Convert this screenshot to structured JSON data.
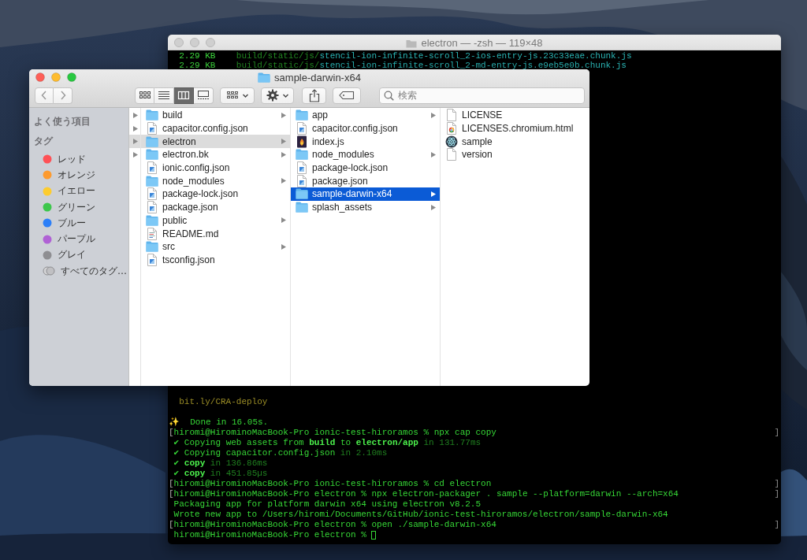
{
  "terminal": {
    "title": "electron — -zsh — 119×48",
    "lines_top": [
      {
        "kind": "text",
        "segments": [
          {
            "text": "  2.29 KB",
            "kind": "size"
          },
          {
            "text": "    build/static/js/",
            "kind": "path"
          },
          {
            "text": "stencil-ion-infinite-scroll_2-ios-entry-js.23c33eae.chunk.js",
            "kind": "file"
          }
        ]
      },
      {
        "kind": "text",
        "segments": [
          {
            "text": "  2.29 KB",
            "kind": "size"
          },
          {
            "text": "    build/static/js/",
            "kind": "path"
          },
          {
            "text": "stencil-ion-infinite-scroll_2-md-entry-js.e9eb5e0b.chunk.js",
            "kind": "file"
          }
        ]
      }
    ],
    "lines_bottom": [
      {
        "kind": "text",
        "segments": [
          {
            "text": "  bit.ly/CRA-deploy",
            "kind": "hint"
          }
        ]
      },
      {
        "kind": "blank"
      },
      {
        "kind": "text",
        "segments": [
          {
            "text": "✨  Done in 16.05s.",
            "kind": "plain"
          }
        ]
      },
      {
        "kind": "text",
        "segments": [
          {
            "text": "[",
            "kind": "bracket"
          },
          {
            "text": "hiromi@HirominoMacBook-Pro ionic-test-hiroramos % npx cap copy",
            "kind": "plain"
          }
        ],
        "end_mark": "]"
      },
      {
        "kind": "text",
        "segments": [
          {
            "text": " ✔ Copying web assets from ",
            "kind": "plain"
          },
          {
            "text": "build",
            "kind": "bold"
          },
          {
            "text": " to ",
            "kind": "plain"
          },
          {
            "text": "electron/app",
            "kind": "bold"
          },
          {
            "text": " in 131.77ms",
            "kind": "dim"
          }
        ]
      },
      {
        "kind": "text",
        "segments": [
          {
            "text": " ✔ Copying capacitor.config.json",
            "kind": "plain"
          },
          {
            "text": " in 2.10ms",
            "kind": "dim"
          }
        ]
      },
      {
        "kind": "text",
        "segments": [
          {
            "text": " ✔ ",
            "kind": "plain"
          },
          {
            "text": "copy",
            "kind": "bold"
          },
          {
            "text": " in 136.86ms",
            "kind": "dim"
          }
        ]
      },
      {
        "kind": "text",
        "segments": [
          {
            "text": " ✔ ",
            "kind": "plain"
          },
          {
            "text": "copy",
            "kind": "bold"
          },
          {
            "text": " in 451.85µs",
            "kind": "dim"
          }
        ]
      },
      {
        "kind": "text",
        "segments": [
          {
            "text": "[",
            "kind": "bracket"
          },
          {
            "text": "hiromi@HirominoMacBook-Pro ionic-test-hiroramos % cd electron",
            "kind": "plain"
          }
        ],
        "end_mark": "]"
      },
      {
        "kind": "text",
        "segments": [
          {
            "text": "[",
            "kind": "bracket"
          },
          {
            "text": "hiromi@HirominoMacBook-Pro electron % npx electron-packager . sample --platform=darwin --arch=x64",
            "kind": "plain"
          }
        ],
        "end_mark": "]"
      },
      {
        "kind": "text",
        "segments": [
          {
            "text": " Packaging app for platform darwin x64 using electron v8.2.5",
            "kind": "plain"
          }
        ]
      },
      {
        "kind": "text",
        "segments": [
          {
            "text": " Wrote new app to /Users/hiromi/Documents/GitHub/ionic-test-hiroramos/electron/sample-darwin-x64",
            "kind": "plain"
          }
        ]
      },
      {
        "kind": "text",
        "segments": [
          {
            "text": "[",
            "kind": "bracket"
          },
          {
            "text": "hiromi@HirominoMacBook-Pro electron % open ./sample-darwin-x64",
            "kind": "plain"
          }
        ],
        "end_mark": "]"
      },
      {
        "kind": "text",
        "segments": [
          {
            "text": " hiromi@HirominoMacBook-Pro electron % ",
            "kind": "plain"
          }
        ],
        "cursor": true
      }
    ]
  },
  "finder": {
    "title": "sample-darwin-x64",
    "toolbar": {
      "view_modes": [
        {
          "kind": "icons",
          "selected": false
        },
        {
          "kind": "list",
          "selected": false
        },
        {
          "kind": "columns",
          "selected": true
        },
        {
          "kind": "gallery",
          "selected": false
        }
      ],
      "search": {
        "placeholder": "検索"
      }
    },
    "sidebar": {
      "sections": [
        {
          "heading": "よく使う項目"
        },
        {
          "heading": "タグ",
          "items": [
            {
              "label": "レッド",
              "kind": "tag",
              "color": "#fe5156"
            },
            {
              "label": "オレンジ",
              "kind": "tag",
              "color": "#fd9a2e"
            },
            {
              "label": "イエロー",
              "kind": "tag",
              "color": "#fdcc2e"
            },
            {
              "label": "グリーン",
              "kind": "tag",
              "color": "#3dc74c"
            },
            {
              "label": "ブルー",
              "kind": "tag",
              "color": "#2c7ff8"
            },
            {
              "label": "パープル",
              "kind": "tag",
              "color": "#b061d5"
            },
            {
              "label": "グレイ",
              "kind": "tag",
              "color": "#8e8e92"
            },
            {
              "label": "すべてのタグ…",
              "kind": "all"
            }
          ]
        }
      ]
    },
    "parent_column": {
      "rows": [
        {
          "selected": false
        },
        {
          "selected": false
        },
        {
          "selected": true
        },
        {
          "selected": false
        }
      ]
    },
    "columns": [
      {
        "items": [
          {
            "name": "build",
            "kind": "folder",
            "has_children": true,
            "selected": false
          },
          {
            "name": "capacitor.config.json",
            "kind": "json",
            "has_children": false,
            "selected": false
          },
          {
            "name": "electron",
            "kind": "folder",
            "has_children": true,
            "selected": true
          },
          {
            "name": "electron.bk",
            "kind": "folder",
            "has_children": true,
            "selected": false
          },
          {
            "name": "ionic.config.json",
            "kind": "json",
            "has_children": false,
            "selected": false
          },
          {
            "name": "node_modules",
            "kind": "folder",
            "has_children": true,
            "selected": false
          },
          {
            "name": "package-lock.json",
            "kind": "json",
            "has_children": false,
            "selected": false
          },
          {
            "name": "package.json",
            "kind": "json",
            "has_children": false,
            "selected": false
          },
          {
            "name": "public",
            "kind": "folder",
            "has_children": true,
            "selected": false
          },
          {
            "name": "README.md",
            "kind": "markdown",
            "has_children": false,
            "selected": false
          },
          {
            "name": "src",
            "kind": "folder",
            "has_children": true,
            "selected": false
          },
          {
            "name": "tsconfig.json",
            "kind": "json",
            "has_children": false,
            "selected": false
          }
        ]
      },
      {
        "items": [
          {
            "name": "app",
            "kind": "folder",
            "has_children": true,
            "selected": false
          },
          {
            "name": "capacitor.config.json",
            "kind": "json",
            "has_children": false,
            "selected": false
          },
          {
            "name": "index.js",
            "kind": "js",
            "has_children": false,
            "selected": false
          },
          {
            "name": "node_modules",
            "kind": "folder",
            "has_children": true,
            "selected": false
          },
          {
            "name": "package-lock.json",
            "kind": "json",
            "has_children": false,
            "selected": false
          },
          {
            "name": "package.json",
            "kind": "json",
            "has_children": false,
            "selected": false
          },
          {
            "name": "sample-darwin-x64",
            "kind": "folder",
            "has_children": true,
            "selected": true
          },
          {
            "name": "splash_assets",
            "kind": "folder",
            "has_children": true,
            "selected": false
          }
        ]
      },
      {
        "items": [
          {
            "name": "LICENSE",
            "kind": "document",
            "has_children": false,
            "selected": false
          },
          {
            "name": "LICENSES.chromium.html",
            "kind": "html",
            "has_children": false,
            "selected": false
          },
          {
            "name": "sample",
            "kind": "app",
            "has_children": false,
            "selected": false
          },
          {
            "name": "version",
            "kind": "document",
            "has_children": false,
            "selected": false
          }
        ]
      }
    ]
  }
}
